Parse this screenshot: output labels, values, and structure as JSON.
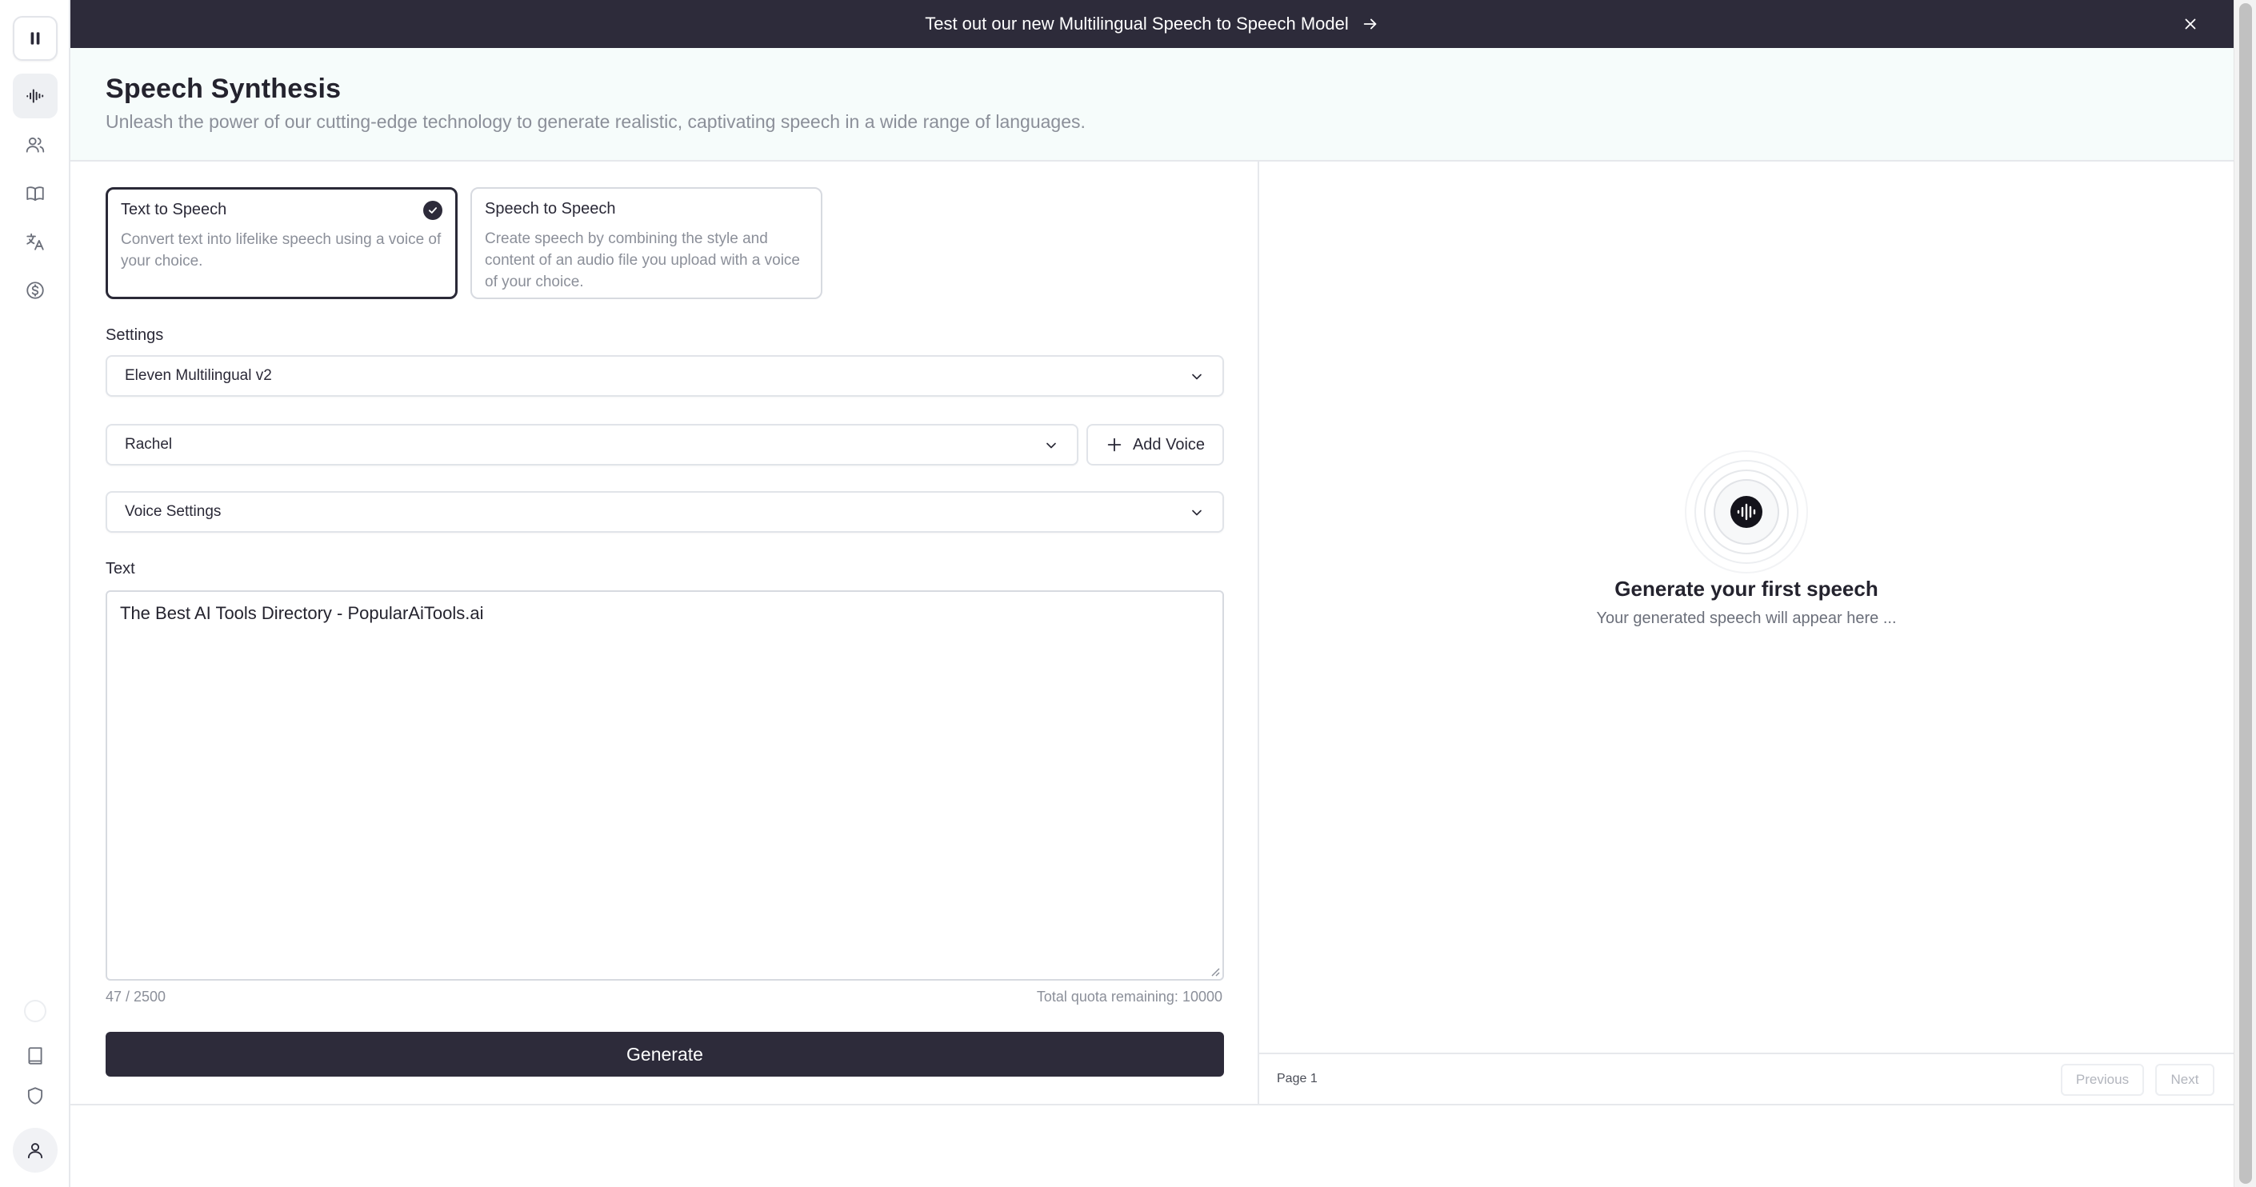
{
  "banner": {
    "text": "Test out our new Multilingual Speech to Speech Model"
  },
  "header": {
    "title": "Speech Synthesis",
    "subtitle": "Unleash the power of our cutting-edge technology to generate realistic, captivating speech in a wide range of languages."
  },
  "modes": [
    {
      "title": "Text to Speech",
      "description": "Convert text into lifelike speech using a voice of your choice.",
      "selected": true
    },
    {
      "title": "Speech to Speech",
      "description": "Create speech by combining the style and content of an audio file you upload with a voice of your choice.",
      "selected": false
    }
  ],
  "settings": {
    "label": "Settings",
    "model": "Eleven Multilingual v2",
    "voice": "Rachel",
    "add_voice_label": "Add Voice",
    "voice_settings": "Voice Settings"
  },
  "text": {
    "label": "Text",
    "value": "The Best AI Tools Directory - PopularAiTools.ai",
    "char_count": "47 / 2500",
    "quota": "Total quota remaining: 10000"
  },
  "generate_label": "Generate",
  "history": {
    "empty_title": "Generate your first speech",
    "empty_subtitle": "Your generated speech will appear here ...",
    "page_label": "Page 1",
    "previous_label": "Previous",
    "next_label": "Next"
  },
  "sidebar_icons": [
    "pause-icon",
    "waveform-icon",
    "users-icon",
    "book-open-icon",
    "translate-icon",
    "dollar-circle-icon",
    "status-circle",
    "docs-icon",
    "shield-icon",
    "user-icon"
  ],
  "colors": {
    "accent": "#2d2b3a",
    "header_bg": "#f6fcfb",
    "muted_text": "#8b8f99",
    "border": "#e1e4e9"
  }
}
